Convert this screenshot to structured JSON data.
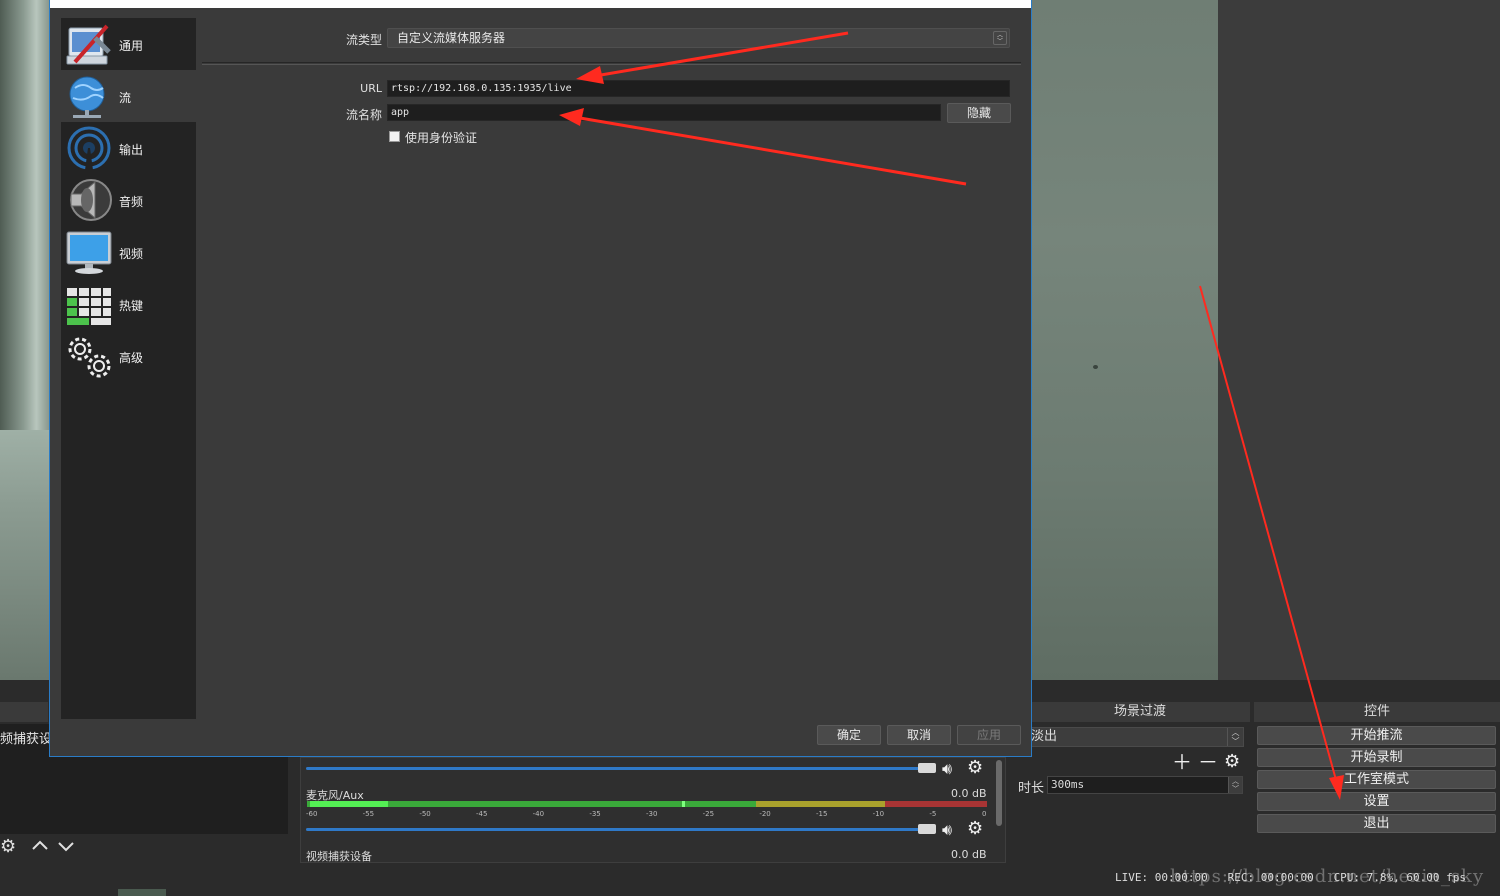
{
  "dialog": {
    "nav": [
      {
        "label": "通用",
        "icon": "general-settings-icon"
      },
      {
        "label": "流",
        "icon": "stream-globe-icon"
      },
      {
        "label": "输出",
        "icon": "output-antenna-icon"
      },
      {
        "label": "音频",
        "icon": "audio-speaker-icon"
      },
      {
        "label": "视频",
        "icon": "video-monitor-icon"
      },
      {
        "label": "热键",
        "icon": "hotkeys-keyboard-icon"
      },
      {
        "label": "高级",
        "icon": "advanced-gears-icon"
      }
    ],
    "active_nav": "流",
    "stream_type_label": "流类型",
    "stream_type_value": "自定义流媒体服务器",
    "url_label": "URL",
    "url_value": "rtsp://192.168.0.135:1935/live",
    "key_label": "流名称",
    "key_value": "app",
    "hide_button": "隐藏",
    "auth_checkbox_label": "使用身份验证",
    "auth_checked": false,
    "ok_button": "确定",
    "cancel_button": "取消",
    "apply_button": "应用"
  },
  "main": {
    "sources_item": "频捕获设备",
    "mixer": {
      "channels": [
        {
          "name": "麦克风/Aux",
          "db": "0.0 dB"
        },
        {
          "name": "视频捕获设备",
          "db": "0.0 dB"
        }
      ],
      "meter_ticks": [
        "-60",
        "-55",
        "-50",
        "-45",
        "-40",
        "-35",
        "-30",
        "-25",
        "-20",
        "-15",
        "-10",
        "-5",
        "0"
      ]
    },
    "transitions": {
      "header": "场景过渡",
      "selected": "淡出",
      "duration_label": "时长",
      "duration_value": "300ms"
    },
    "controls": {
      "header": "控件",
      "buttons": [
        "开始推流",
        "开始录制",
        "工作室模式",
        "设置",
        "退出"
      ]
    },
    "status": {
      "live": "LIVE: 00:00:00",
      "rec": "REC: 00:00:00",
      "cpu": "CPU: 7.8%, 60.00 fps"
    },
    "watermark": "https://blog.csdn.net/hexin_sky"
  },
  "colors": {
    "annotation_arrow": "#ff2a1f",
    "dialog_border": "#2a7cc7",
    "slider": "#2f79c8"
  }
}
